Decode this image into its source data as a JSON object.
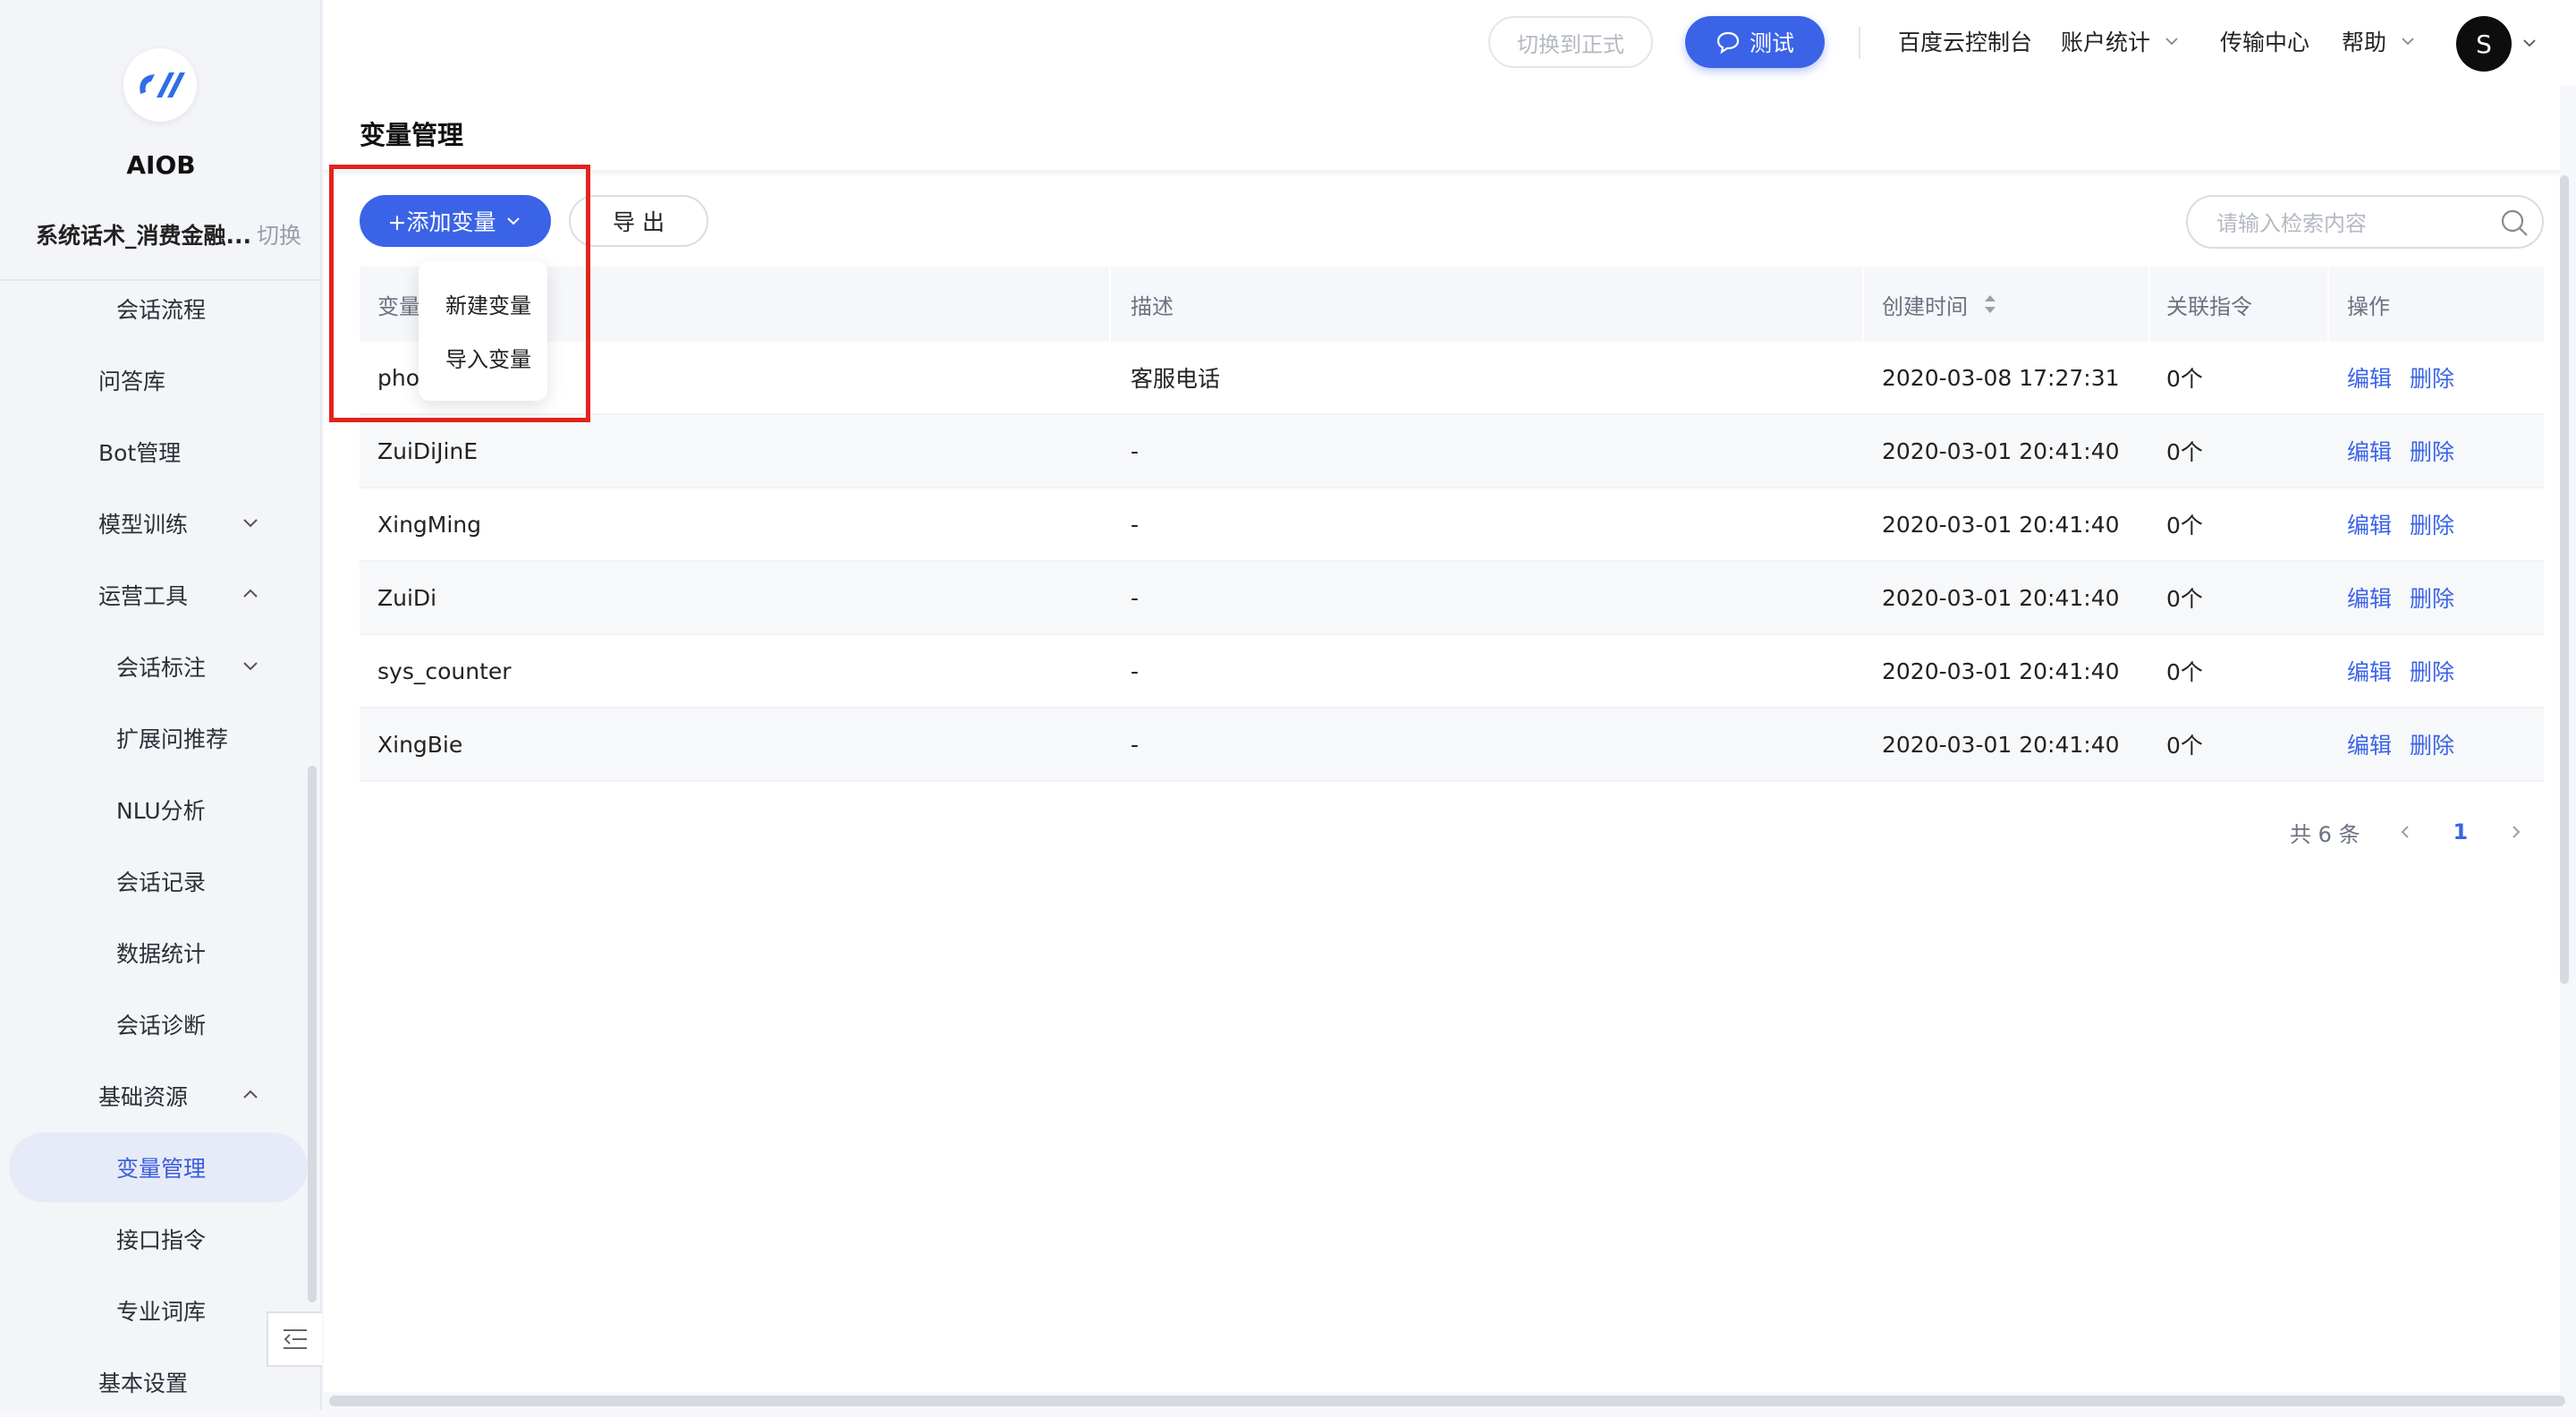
{
  "app": {
    "brand": "AIOB"
  },
  "project": {
    "name": "系统话术_消费金融...",
    "switch_label": "切换"
  },
  "sidebar": {
    "items": [
      {
        "label": "会话流程"
      },
      {
        "label": "问答库"
      },
      {
        "label": "Bot管理"
      },
      {
        "label": "模型训练"
      },
      {
        "label": "运营工具"
      },
      {
        "label": "会话标注"
      },
      {
        "label": "扩展问推荐"
      },
      {
        "label": "NLU分析"
      },
      {
        "label": "会话记录"
      },
      {
        "label": "数据统计"
      },
      {
        "label": "会话诊断"
      },
      {
        "label": "基础资源"
      },
      {
        "label": "变量管理"
      },
      {
        "label": "接口指令"
      },
      {
        "label": "专业词库"
      },
      {
        "label": "基本设置"
      }
    ]
  },
  "topbar": {
    "switch_label": "切换到正式",
    "test_label": "测试",
    "links": [
      "百度云控制台",
      "账户统计",
      "传输中心",
      "帮助"
    ],
    "avatar_letter": "S"
  },
  "page": {
    "title": "变量管理",
    "add_label": "+添加变量",
    "export_label": "导 出",
    "search_placeholder": "请输入检索内容"
  },
  "dropdown": {
    "items": [
      "新建变量",
      "导入变量"
    ]
  },
  "table": {
    "headers": [
      "变量",
      "描述",
      "创建时间",
      "关联指令",
      "操作"
    ],
    "actions": {
      "edit": "编辑",
      "delete": "删除"
    },
    "rows": [
      {
        "name": "pho",
        "desc": "客服电话",
        "time": "2020-03-08 17:27:31",
        "count": "0个"
      },
      {
        "name": "ZuiDiJinE",
        "desc": "-",
        "time": "2020-03-01 20:41:40",
        "count": "0个"
      },
      {
        "name": "XingMing",
        "desc": "-",
        "time": "2020-03-01 20:41:40",
        "count": "0个"
      },
      {
        "name": "ZuiDi",
        "desc": "-",
        "time": "2020-03-01 20:41:40",
        "count": "0个"
      },
      {
        "name": "sys_counter",
        "desc": "-",
        "time": "2020-03-01 20:41:40",
        "count": "0个"
      },
      {
        "name": "XingBie",
        "desc": "-",
        "time": "2020-03-01 20:41:40",
        "count": "0个"
      }
    ]
  },
  "pager": {
    "total": "共 6 条",
    "page": "1"
  },
  "colors": {
    "primary": "#3a63e8",
    "highlight": "#e3231b"
  }
}
